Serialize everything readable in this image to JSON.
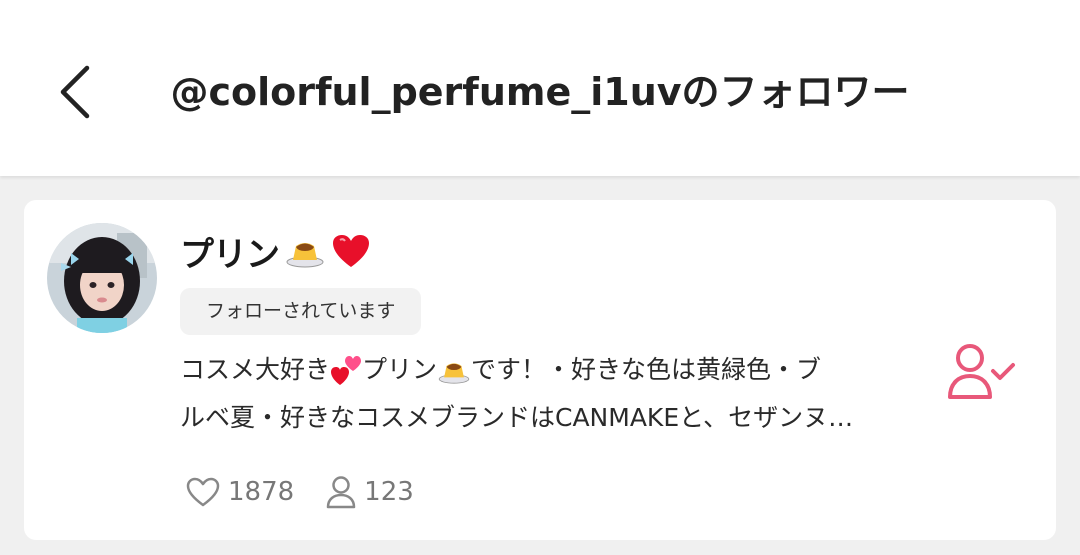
{
  "header": {
    "title": "@colorful_perfume_i1uvのフォロワー"
  },
  "user": {
    "name": "プリン",
    "name_emojis": [
      "pudding-icon",
      "heart-icon"
    ],
    "follow_status": "フォローされています",
    "bio_line1_a": "コスメ大好き",
    "bio_line1_b": "プリン",
    "bio_line1_c": "です！・好きな色は黄緑色・ブ",
    "bio_line2": "ルベ夏・好きなコスメブランドはCANMAKEと、セザンヌ…",
    "likes": "1878",
    "followers": "123"
  },
  "colors": {
    "accent": "#e8587a",
    "heart": "#e8102a",
    "muted": "#777777"
  }
}
